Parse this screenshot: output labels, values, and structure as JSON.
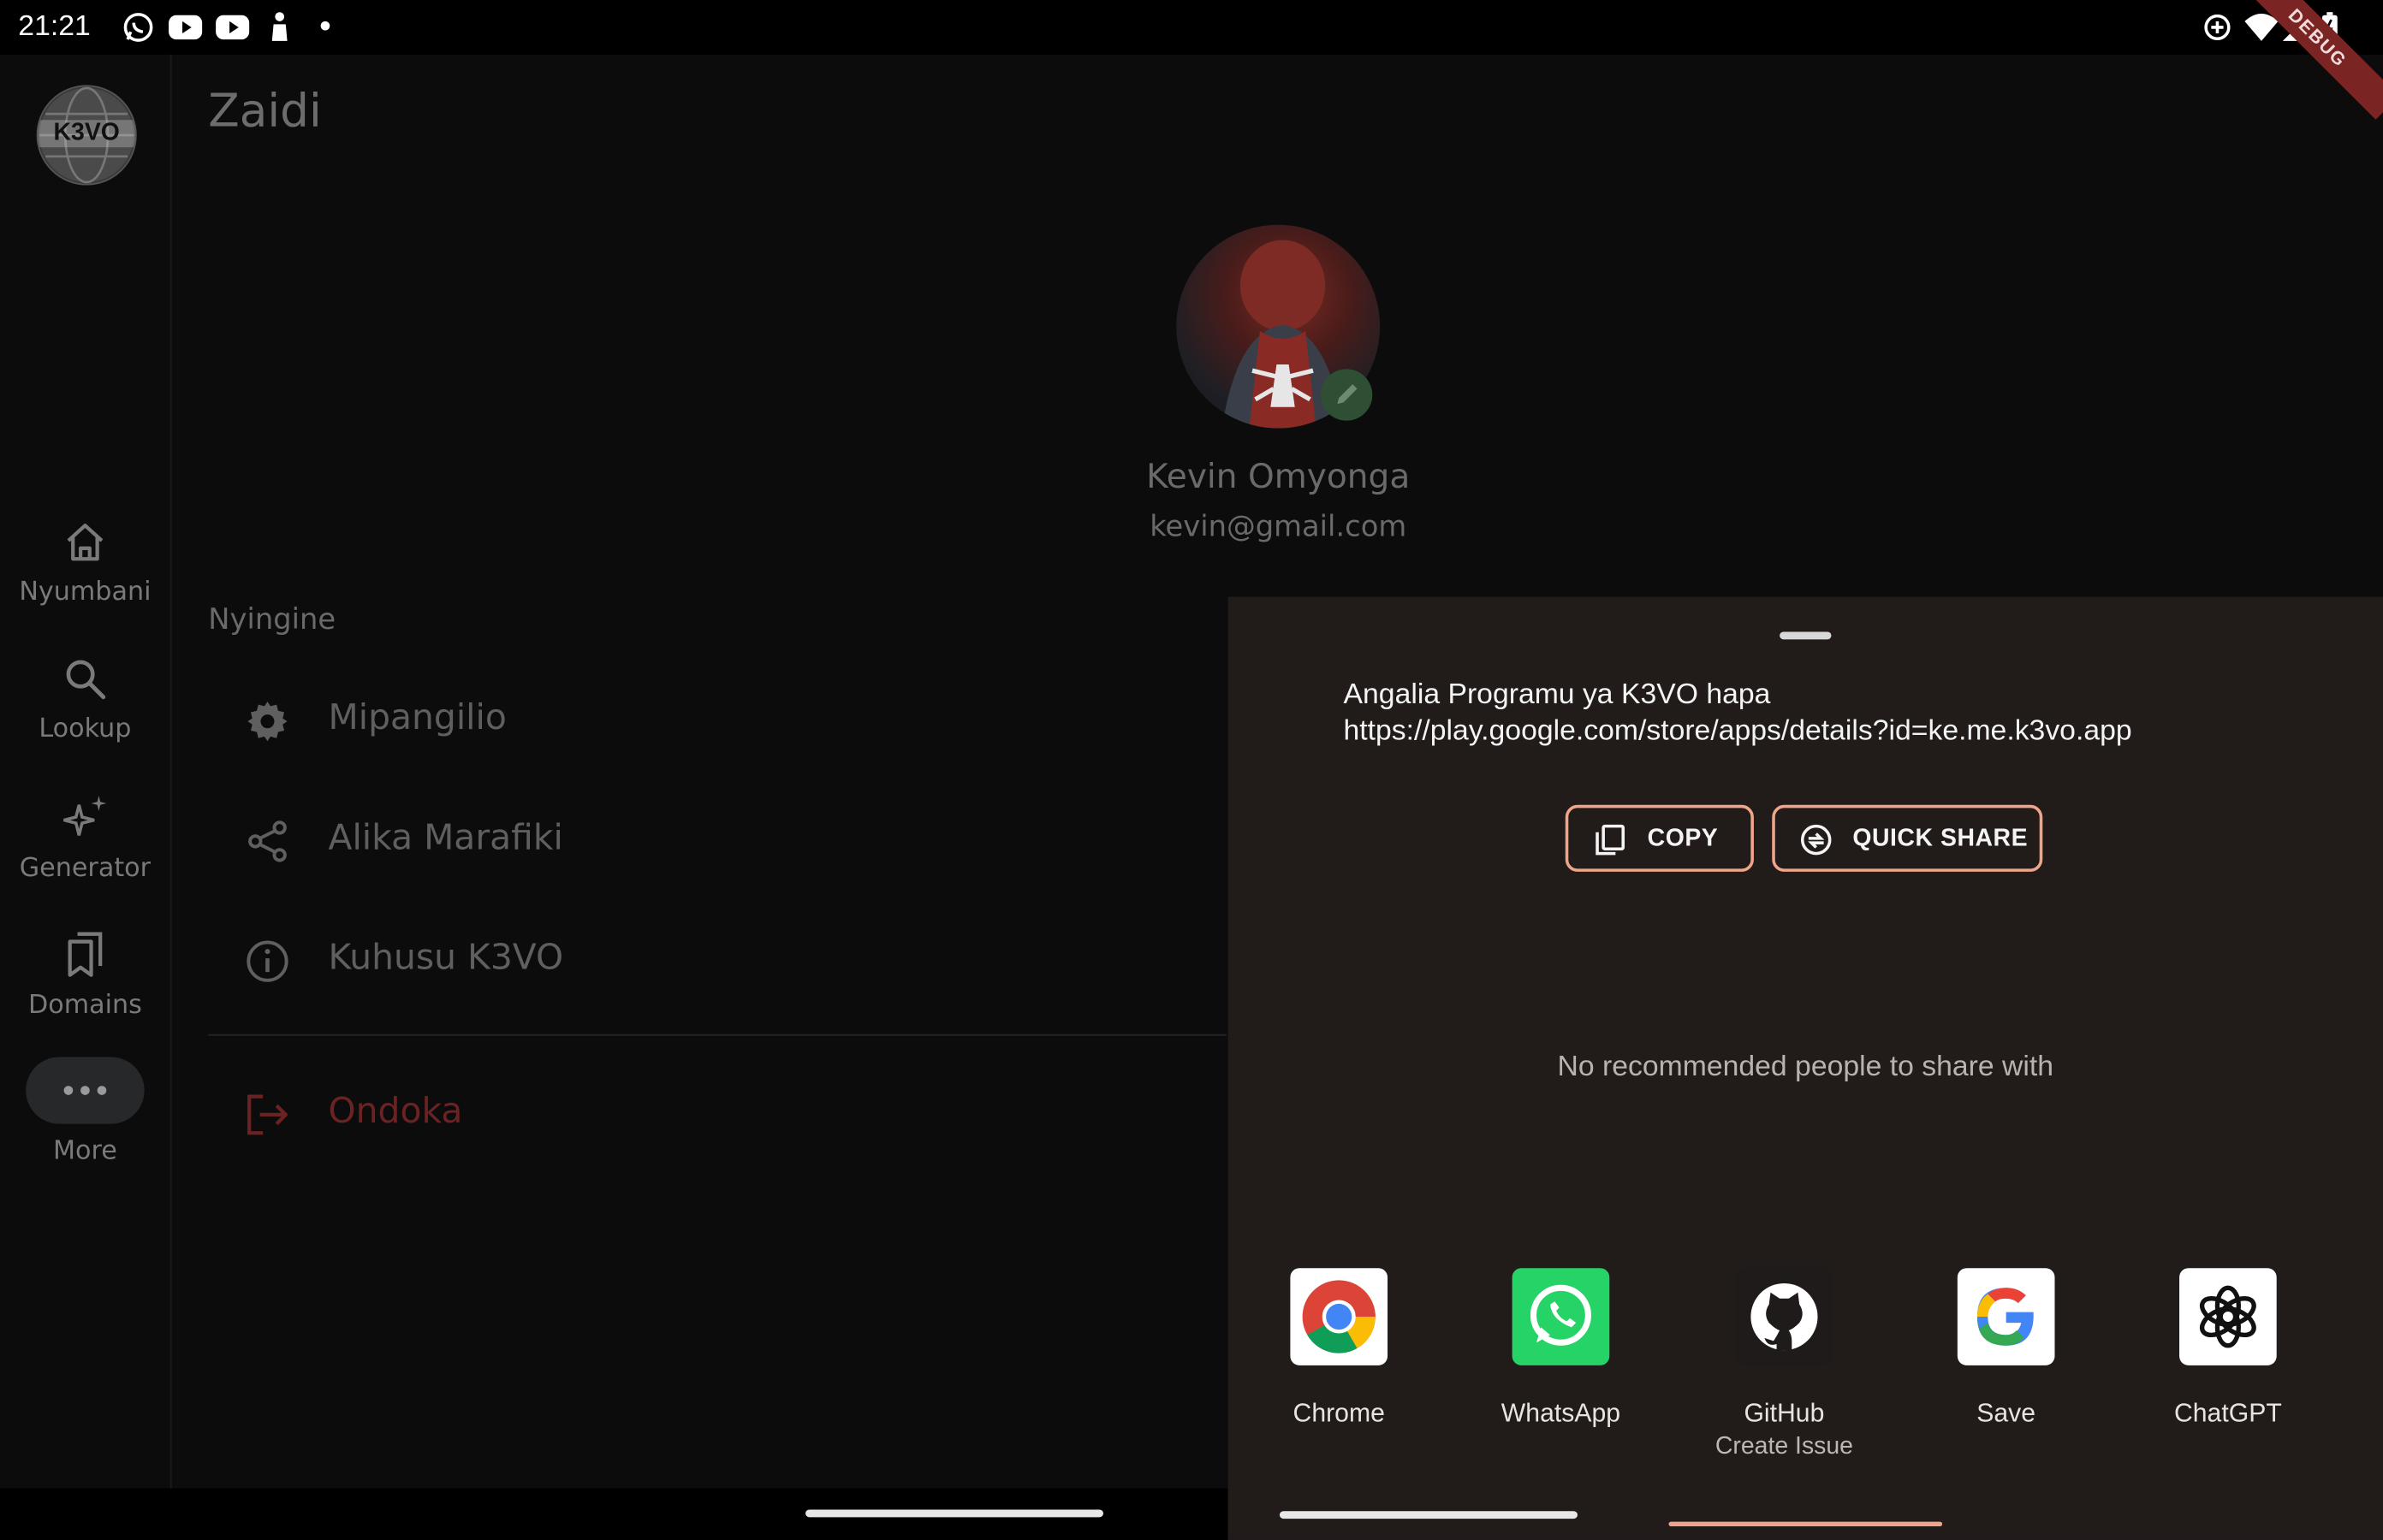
{
  "status_bar": {
    "time": "21:21",
    "debug_label": "DEBUG"
  },
  "rail": {
    "logo_text": "K3VO",
    "items": [
      {
        "label": "Nyumbani",
        "icon": "home-icon"
      },
      {
        "label": "Lookup",
        "icon": "search-icon"
      },
      {
        "label": "Generator",
        "icon": "sparkles-icon"
      },
      {
        "label": "Domains",
        "icon": "bookmarks-icon"
      },
      {
        "label": "More",
        "icon": "more-horizontal-icon"
      }
    ]
  },
  "main": {
    "title": "Zaidi",
    "profile": {
      "name": "Kevin Omyonga",
      "email": "kevin@gmail.com"
    },
    "section_header": "Nyingine",
    "menu": [
      {
        "label": "Mipangilio",
        "icon": "gear-icon"
      },
      {
        "label": "Alika Marafiki",
        "icon": "share-icon"
      },
      {
        "label": "Kuhusu K3VO",
        "icon": "info-icon"
      }
    ],
    "logout_label": "Ondoka"
  },
  "share_sheet": {
    "text_line1": "Angalia Programu ya K3VO hapa",
    "text_line2": "https://play.google.com/store/apps/details?id=ke.me.k3vo.app",
    "copy_label": "COPY",
    "quick_share_label": "QUICK SHARE",
    "no_people_text": "No recommended people to share with",
    "apps": [
      {
        "label": "Chrome",
        "sublabel": ""
      },
      {
        "label": "WhatsApp",
        "sublabel": ""
      },
      {
        "label": "GitHub",
        "sublabel": "Create Issue"
      },
      {
        "label": "Save",
        "sublabel": ""
      },
      {
        "label": "ChatGPT",
        "sublabel": ""
      }
    ],
    "accent_color": "#f0a58a"
  }
}
